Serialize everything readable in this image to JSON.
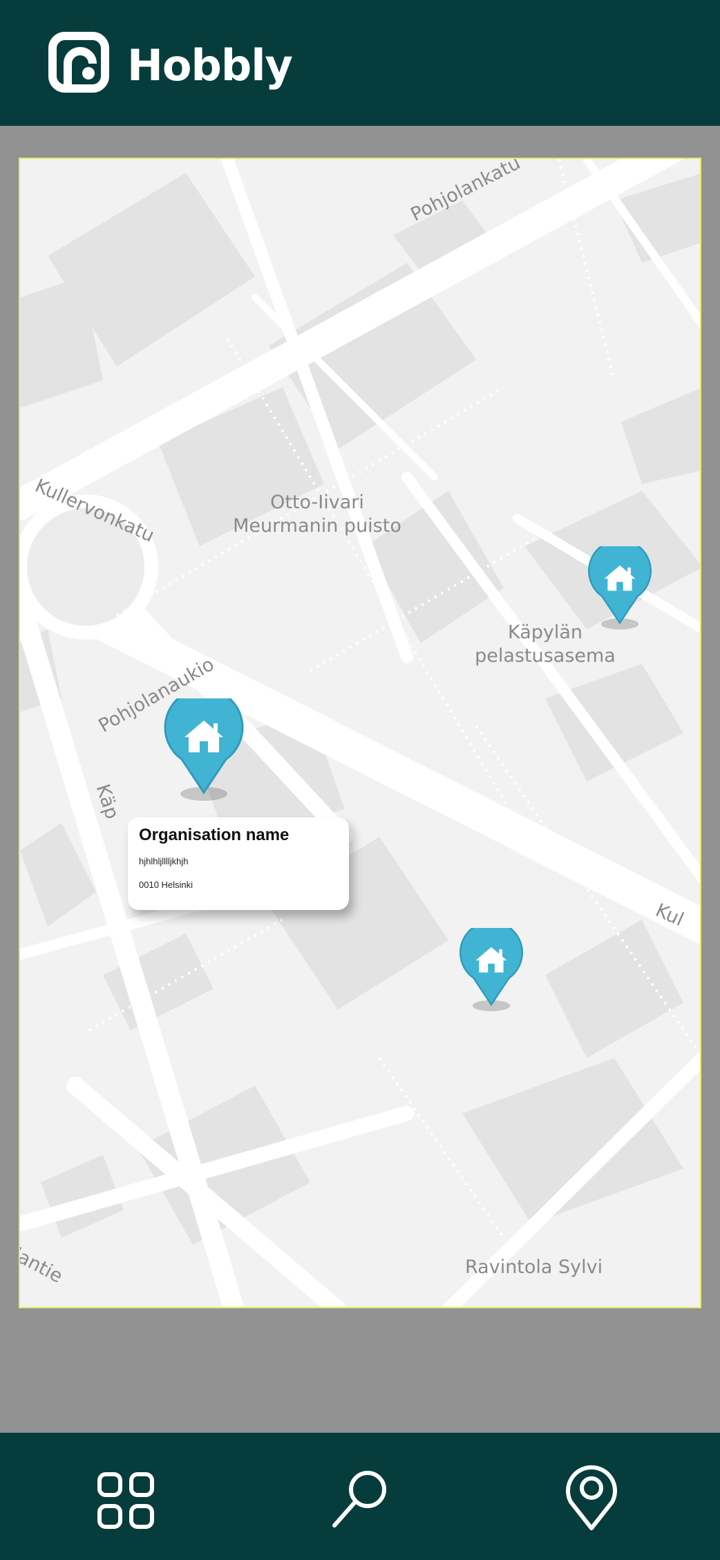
{
  "app": {
    "title": "Hobbly"
  },
  "map": {
    "streets": [
      "Pohjolankatu",
      "Kullervonkatu",
      "Pohjolanaukio",
      "Käp",
      "Kul",
      "lantie"
    ],
    "places": [
      "Otto-Iivari\nMeurmanin puisto",
      "Käpylän\npelastusasema",
      "Ravintola Sylvi"
    ],
    "markers": [
      {
        "name": "marker-home",
        "icon": "house-icon",
        "selected": true
      },
      {
        "name": "marker-home",
        "icon": "house-icon",
        "selected": false
      },
      {
        "name": "marker-home",
        "icon": "house-icon",
        "selected": false
      }
    ]
  },
  "popup": {
    "name": "Organisation name",
    "address_line1": "hjhlhljlllljkhjh",
    "address_line2": "0010 Helsinki"
  },
  "nav": {
    "items": [
      {
        "icon": "grid-icon",
        "label": ""
      },
      {
        "icon": "search-icon",
        "label": ""
      },
      {
        "icon": "location-pin-icon",
        "label": ""
      }
    ]
  },
  "colors": {
    "header": "#063c3c",
    "background": "#929292",
    "map_border": "#e6ec6a",
    "marker": "#41b4d4"
  }
}
